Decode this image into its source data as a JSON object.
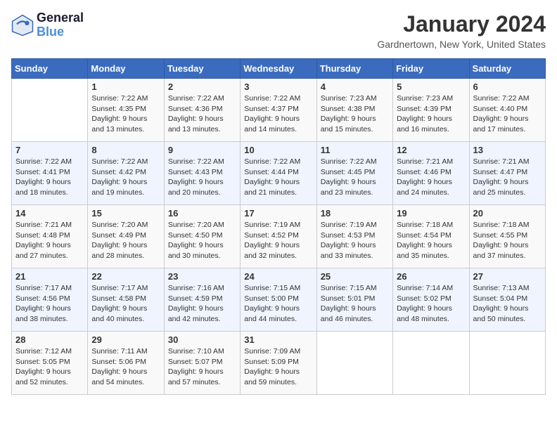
{
  "logo": {
    "line1": "General",
    "line2": "Blue"
  },
  "title": "January 2024",
  "location": "Gardnertown, New York, United States",
  "days_of_week": [
    "Sunday",
    "Monday",
    "Tuesday",
    "Wednesday",
    "Thursday",
    "Friday",
    "Saturday"
  ],
  "weeks": [
    [
      {
        "day": "",
        "info": ""
      },
      {
        "day": "1",
        "info": "Sunrise: 7:22 AM\nSunset: 4:35 PM\nDaylight: 9 hours\nand 13 minutes."
      },
      {
        "day": "2",
        "info": "Sunrise: 7:22 AM\nSunset: 4:36 PM\nDaylight: 9 hours\nand 13 minutes."
      },
      {
        "day": "3",
        "info": "Sunrise: 7:22 AM\nSunset: 4:37 PM\nDaylight: 9 hours\nand 14 minutes."
      },
      {
        "day": "4",
        "info": "Sunrise: 7:23 AM\nSunset: 4:38 PM\nDaylight: 9 hours\nand 15 minutes."
      },
      {
        "day": "5",
        "info": "Sunrise: 7:23 AM\nSunset: 4:39 PM\nDaylight: 9 hours\nand 16 minutes."
      },
      {
        "day": "6",
        "info": "Sunrise: 7:22 AM\nSunset: 4:40 PM\nDaylight: 9 hours\nand 17 minutes."
      }
    ],
    [
      {
        "day": "7",
        "info": "Sunrise: 7:22 AM\nSunset: 4:41 PM\nDaylight: 9 hours\nand 18 minutes."
      },
      {
        "day": "8",
        "info": "Sunrise: 7:22 AM\nSunset: 4:42 PM\nDaylight: 9 hours\nand 19 minutes."
      },
      {
        "day": "9",
        "info": "Sunrise: 7:22 AM\nSunset: 4:43 PM\nDaylight: 9 hours\nand 20 minutes."
      },
      {
        "day": "10",
        "info": "Sunrise: 7:22 AM\nSunset: 4:44 PM\nDaylight: 9 hours\nand 21 minutes."
      },
      {
        "day": "11",
        "info": "Sunrise: 7:22 AM\nSunset: 4:45 PM\nDaylight: 9 hours\nand 23 minutes."
      },
      {
        "day": "12",
        "info": "Sunrise: 7:21 AM\nSunset: 4:46 PM\nDaylight: 9 hours\nand 24 minutes."
      },
      {
        "day": "13",
        "info": "Sunrise: 7:21 AM\nSunset: 4:47 PM\nDaylight: 9 hours\nand 25 minutes."
      }
    ],
    [
      {
        "day": "14",
        "info": "Sunrise: 7:21 AM\nSunset: 4:48 PM\nDaylight: 9 hours\nand 27 minutes."
      },
      {
        "day": "15",
        "info": "Sunrise: 7:20 AM\nSunset: 4:49 PM\nDaylight: 9 hours\nand 28 minutes."
      },
      {
        "day": "16",
        "info": "Sunrise: 7:20 AM\nSunset: 4:50 PM\nDaylight: 9 hours\nand 30 minutes."
      },
      {
        "day": "17",
        "info": "Sunrise: 7:19 AM\nSunset: 4:52 PM\nDaylight: 9 hours\nand 32 minutes."
      },
      {
        "day": "18",
        "info": "Sunrise: 7:19 AM\nSunset: 4:53 PM\nDaylight: 9 hours\nand 33 minutes."
      },
      {
        "day": "19",
        "info": "Sunrise: 7:18 AM\nSunset: 4:54 PM\nDaylight: 9 hours\nand 35 minutes."
      },
      {
        "day": "20",
        "info": "Sunrise: 7:18 AM\nSunset: 4:55 PM\nDaylight: 9 hours\nand 37 minutes."
      }
    ],
    [
      {
        "day": "21",
        "info": "Sunrise: 7:17 AM\nSunset: 4:56 PM\nDaylight: 9 hours\nand 38 minutes."
      },
      {
        "day": "22",
        "info": "Sunrise: 7:17 AM\nSunset: 4:58 PM\nDaylight: 9 hours\nand 40 minutes."
      },
      {
        "day": "23",
        "info": "Sunrise: 7:16 AM\nSunset: 4:59 PM\nDaylight: 9 hours\nand 42 minutes."
      },
      {
        "day": "24",
        "info": "Sunrise: 7:15 AM\nSunset: 5:00 PM\nDaylight: 9 hours\nand 44 minutes."
      },
      {
        "day": "25",
        "info": "Sunrise: 7:15 AM\nSunset: 5:01 PM\nDaylight: 9 hours\nand 46 minutes."
      },
      {
        "day": "26",
        "info": "Sunrise: 7:14 AM\nSunset: 5:02 PM\nDaylight: 9 hours\nand 48 minutes."
      },
      {
        "day": "27",
        "info": "Sunrise: 7:13 AM\nSunset: 5:04 PM\nDaylight: 9 hours\nand 50 minutes."
      }
    ],
    [
      {
        "day": "28",
        "info": "Sunrise: 7:12 AM\nSunset: 5:05 PM\nDaylight: 9 hours\nand 52 minutes."
      },
      {
        "day": "29",
        "info": "Sunrise: 7:11 AM\nSunset: 5:06 PM\nDaylight: 9 hours\nand 54 minutes."
      },
      {
        "day": "30",
        "info": "Sunrise: 7:10 AM\nSunset: 5:07 PM\nDaylight: 9 hours\nand 57 minutes."
      },
      {
        "day": "31",
        "info": "Sunrise: 7:09 AM\nSunset: 5:09 PM\nDaylight: 9 hours\nand 59 minutes."
      },
      {
        "day": "",
        "info": ""
      },
      {
        "day": "",
        "info": ""
      },
      {
        "day": "",
        "info": ""
      }
    ]
  ]
}
